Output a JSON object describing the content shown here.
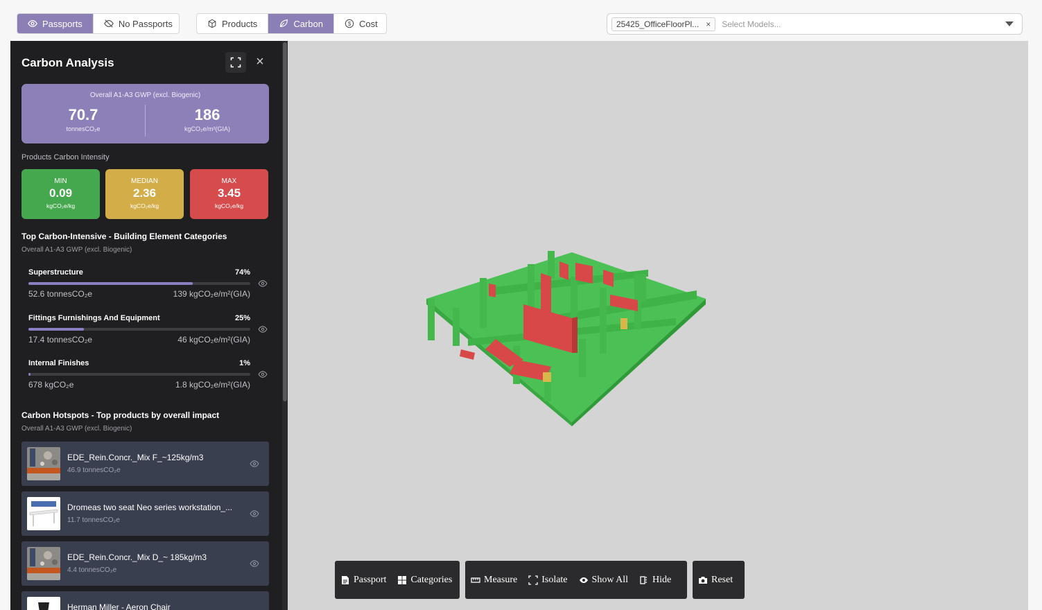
{
  "toolbar": {
    "passports": "Passports",
    "no_passports": "No Passports",
    "products": "Products",
    "carbon": "Carbon",
    "cost": "Cost"
  },
  "model_select": {
    "chip": "25425_OfficeFloorPl...",
    "chip_close": "×",
    "placeholder": "Select Models..."
  },
  "panel": {
    "title": "Carbon Analysis",
    "close": "×",
    "overall_label": "Overall A1-A3 GWP (excl. Biogenic)",
    "total_value": "70.7",
    "total_unit": "tonnesCO₂e",
    "intensity_value": "186",
    "intensity_unit": "kgCO₂e/m²(GIA)",
    "products_intensity_label": "Products Carbon Intensity",
    "intensity": [
      {
        "label": "MIN",
        "value": "0.09",
        "unit": "kgCO₂e/kg",
        "color": "#46a84e"
      },
      {
        "label": "MEDIAN",
        "value": "2.36",
        "unit": "kgCO₂e/kg",
        "color": "#d3ad47"
      },
      {
        "label": "MAX",
        "value": "3.45",
        "unit": "kgCO₂e/kg",
        "color": "#d64c4c"
      }
    ],
    "categories_title": "Top Carbon-Intensive - Building Element Categories",
    "categories_sub": "Overall A1-A3 GWP (excl. Biogenic)",
    "categories": [
      {
        "name": "Superstructure",
        "pct": "74%",
        "fraction": 0.74,
        "total": "52.6 tonnesCO₂e",
        "intensity": "139 kgCO₂e/m²(GIA)"
      },
      {
        "name": "Fittings Furnishings And Equipment",
        "pct": "25%",
        "fraction": 0.25,
        "total": "17.4 tonnesCO₂e",
        "intensity": "46 kgCO₂e/m²(GIA)"
      },
      {
        "name": "Internal Finishes",
        "pct": "1%",
        "fraction": 0.01,
        "total": "678 kgCO₂e",
        "intensity": "1.8 kgCO₂e/m²(GIA)"
      }
    ],
    "hotspots_title": "Carbon Hotspots - Top products by overall impact",
    "hotspots_sub": "Overall A1-A3 GWP (excl. Biogenic)",
    "products": [
      {
        "name": "EDE_Rein.Concr._Mix F_~125kg/m3",
        "value": "46.9 tonnesCO₂e"
      },
      {
        "name": "Dromeas two seat Neo series workstation_...",
        "value": "11.7 tonnesCO₂e"
      },
      {
        "name": "EDE_Rein.Concr._Mix D_~ 185kg/m3",
        "value": "4.4 tonnesCO₂e"
      },
      {
        "name": "Herman Miller - Aeron Chair",
        "value": ""
      }
    ]
  },
  "viewer_tools": {
    "passport": "Passport",
    "categories": "Categories",
    "measure": "Measure",
    "isolate": "Isolate",
    "show_all": "Show All",
    "hide": "Hide",
    "reset": "Reset"
  }
}
